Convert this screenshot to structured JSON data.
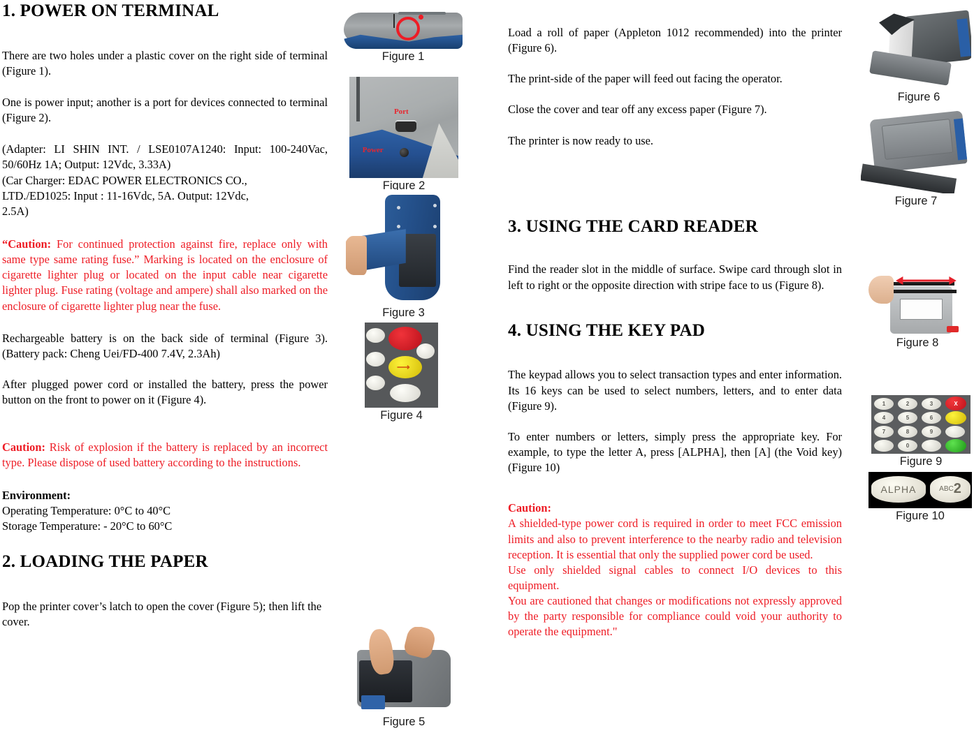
{
  "left_column": {
    "heading": "1. POWER ON TERMINAL",
    "paragraphs": [
      "There are two holes under a plastic cover on the right side of terminal (Figure 1).",
      "One is power input; another is a port for devices connected to terminal (Figure 2)."
    ],
    "adapter_line": "(Adapter: LI SHIN INT. / LSE0107A1240: Input: 100-240Vac, 50/60Hz 1A; Output: 12Vdc, 3.33A)",
    "car_charger_lines": [
      "(Car Charger: EDAC POWER ELECTRONICS CO.,",
      "LTD./ED1025: Input : 11-16Vdc, 5A. Output: 12Vdc,",
      "2.5A)"
    ],
    "caution_fuse_label": "“Caution:",
    "caution_fuse_body": " For continued protection against fire, replace only with same type same rating fuse.” Marking is located on the enclosure of cigarette lighter plug or located on the input cable near cigarette lighter plug. Fuse rating (voltage and ampere) shall also marked on the enclosure of cigarette lighter plug near the fuse.",
    "battery_paragraph": "Rechargeable battery is on the back side of terminal (Figure 3). (Battery pack: Cheng Uei/FD-400 7.4V, 2.3Ah)",
    "power_on_paragraph": "After plugged power cord or installed the battery, press the power button on the front to power on it (Figure 4).",
    "caution_battery_label": "Caution:",
    "caution_battery_body": " Risk of explosion if the battery is replaced by an incorrect type. Please dispose of used battery according to the instructions.",
    "environment_label": "Environment:",
    "environment_lines": [
      "Operating Temperature: 0°C to 40°C",
      "Storage Temperature: - 20°C to 60°C"
    ],
    "heading2": "2. LOADING THE PAPER",
    "paper_paragraph": "Pop the printer cover’s latch to open the cover (Figure 5); then lift the cover."
  },
  "mid_column": {
    "paragraphs": [
      "Load a roll of paper (Appleton 1012 recommended) into the printer (Figure 6).",
      "The print-side of the paper will feed out facing the operator.",
      "Close the cover and tear off any excess paper (Figure 7).",
      "The printer is now ready to use."
    ],
    "heading3": "3. USING THE CARD READER",
    "card_reader_paragraph": "Find the reader slot in the middle of surface. Swipe card through slot in left to right or the opposite direction with stripe face to us (Figure 8).",
    "heading4": "4. USING THE KEY PAD",
    "keypad_paragraph_1": "The keypad allows you to select transaction types and enter information. Its 16 keys can be used to select numbers, letters, and to enter data (Figure 9).",
    "keypad_paragraph_2": "To enter numbers or letters, simply press the appropriate key. For example, to type the letter A, press [ALPHA], then [A] (the Void key) (Figure 10)",
    "caution_fcc_label": "Caution:",
    "caution_fcc_lines": [
      "A shielded-type power cord is required in order to meet FCC emission limits and also to prevent interference to the nearby radio and television reception. It is essential that only the supplied power cord be used.",
      "Use only shielded signal cables to connect I/O devices to this equipment.",
      "You are cautioned that changes or modifications not expressly approved by the party responsible for compliance could void your authority to operate the equipment.\""
    ]
  },
  "figures": {
    "fig1": {
      "caption": "Figure 1"
    },
    "fig2": {
      "caption": "Figure 2",
      "label_port": "Port",
      "label_power": "Power"
    },
    "fig3": {
      "caption": "Figure 3"
    },
    "fig4": {
      "caption": "Figure 4"
    },
    "fig5": {
      "caption": "Figure 5"
    },
    "fig6": {
      "caption": "Figure 6"
    },
    "fig7": {
      "caption": "Figure 7"
    },
    "fig8": {
      "caption": "Figure 8"
    },
    "fig9": {
      "caption": "Figure 9",
      "keys": [
        "1",
        "2",
        "3",
        "X",
        "4",
        "5",
        "6",
        "",
        "7",
        "8",
        "9",
        "",
        "",
        "0",
        "",
        ""
      ]
    },
    "fig10": {
      "caption": "Figure 10",
      "key_left": "ALPHA",
      "key_right_abc": "ABC",
      "key_right_num": "2"
    }
  },
  "colors": {
    "caution_red": "#ee1c25",
    "terminal_blue": "#2f63a8",
    "body_black": "#000000"
  }
}
